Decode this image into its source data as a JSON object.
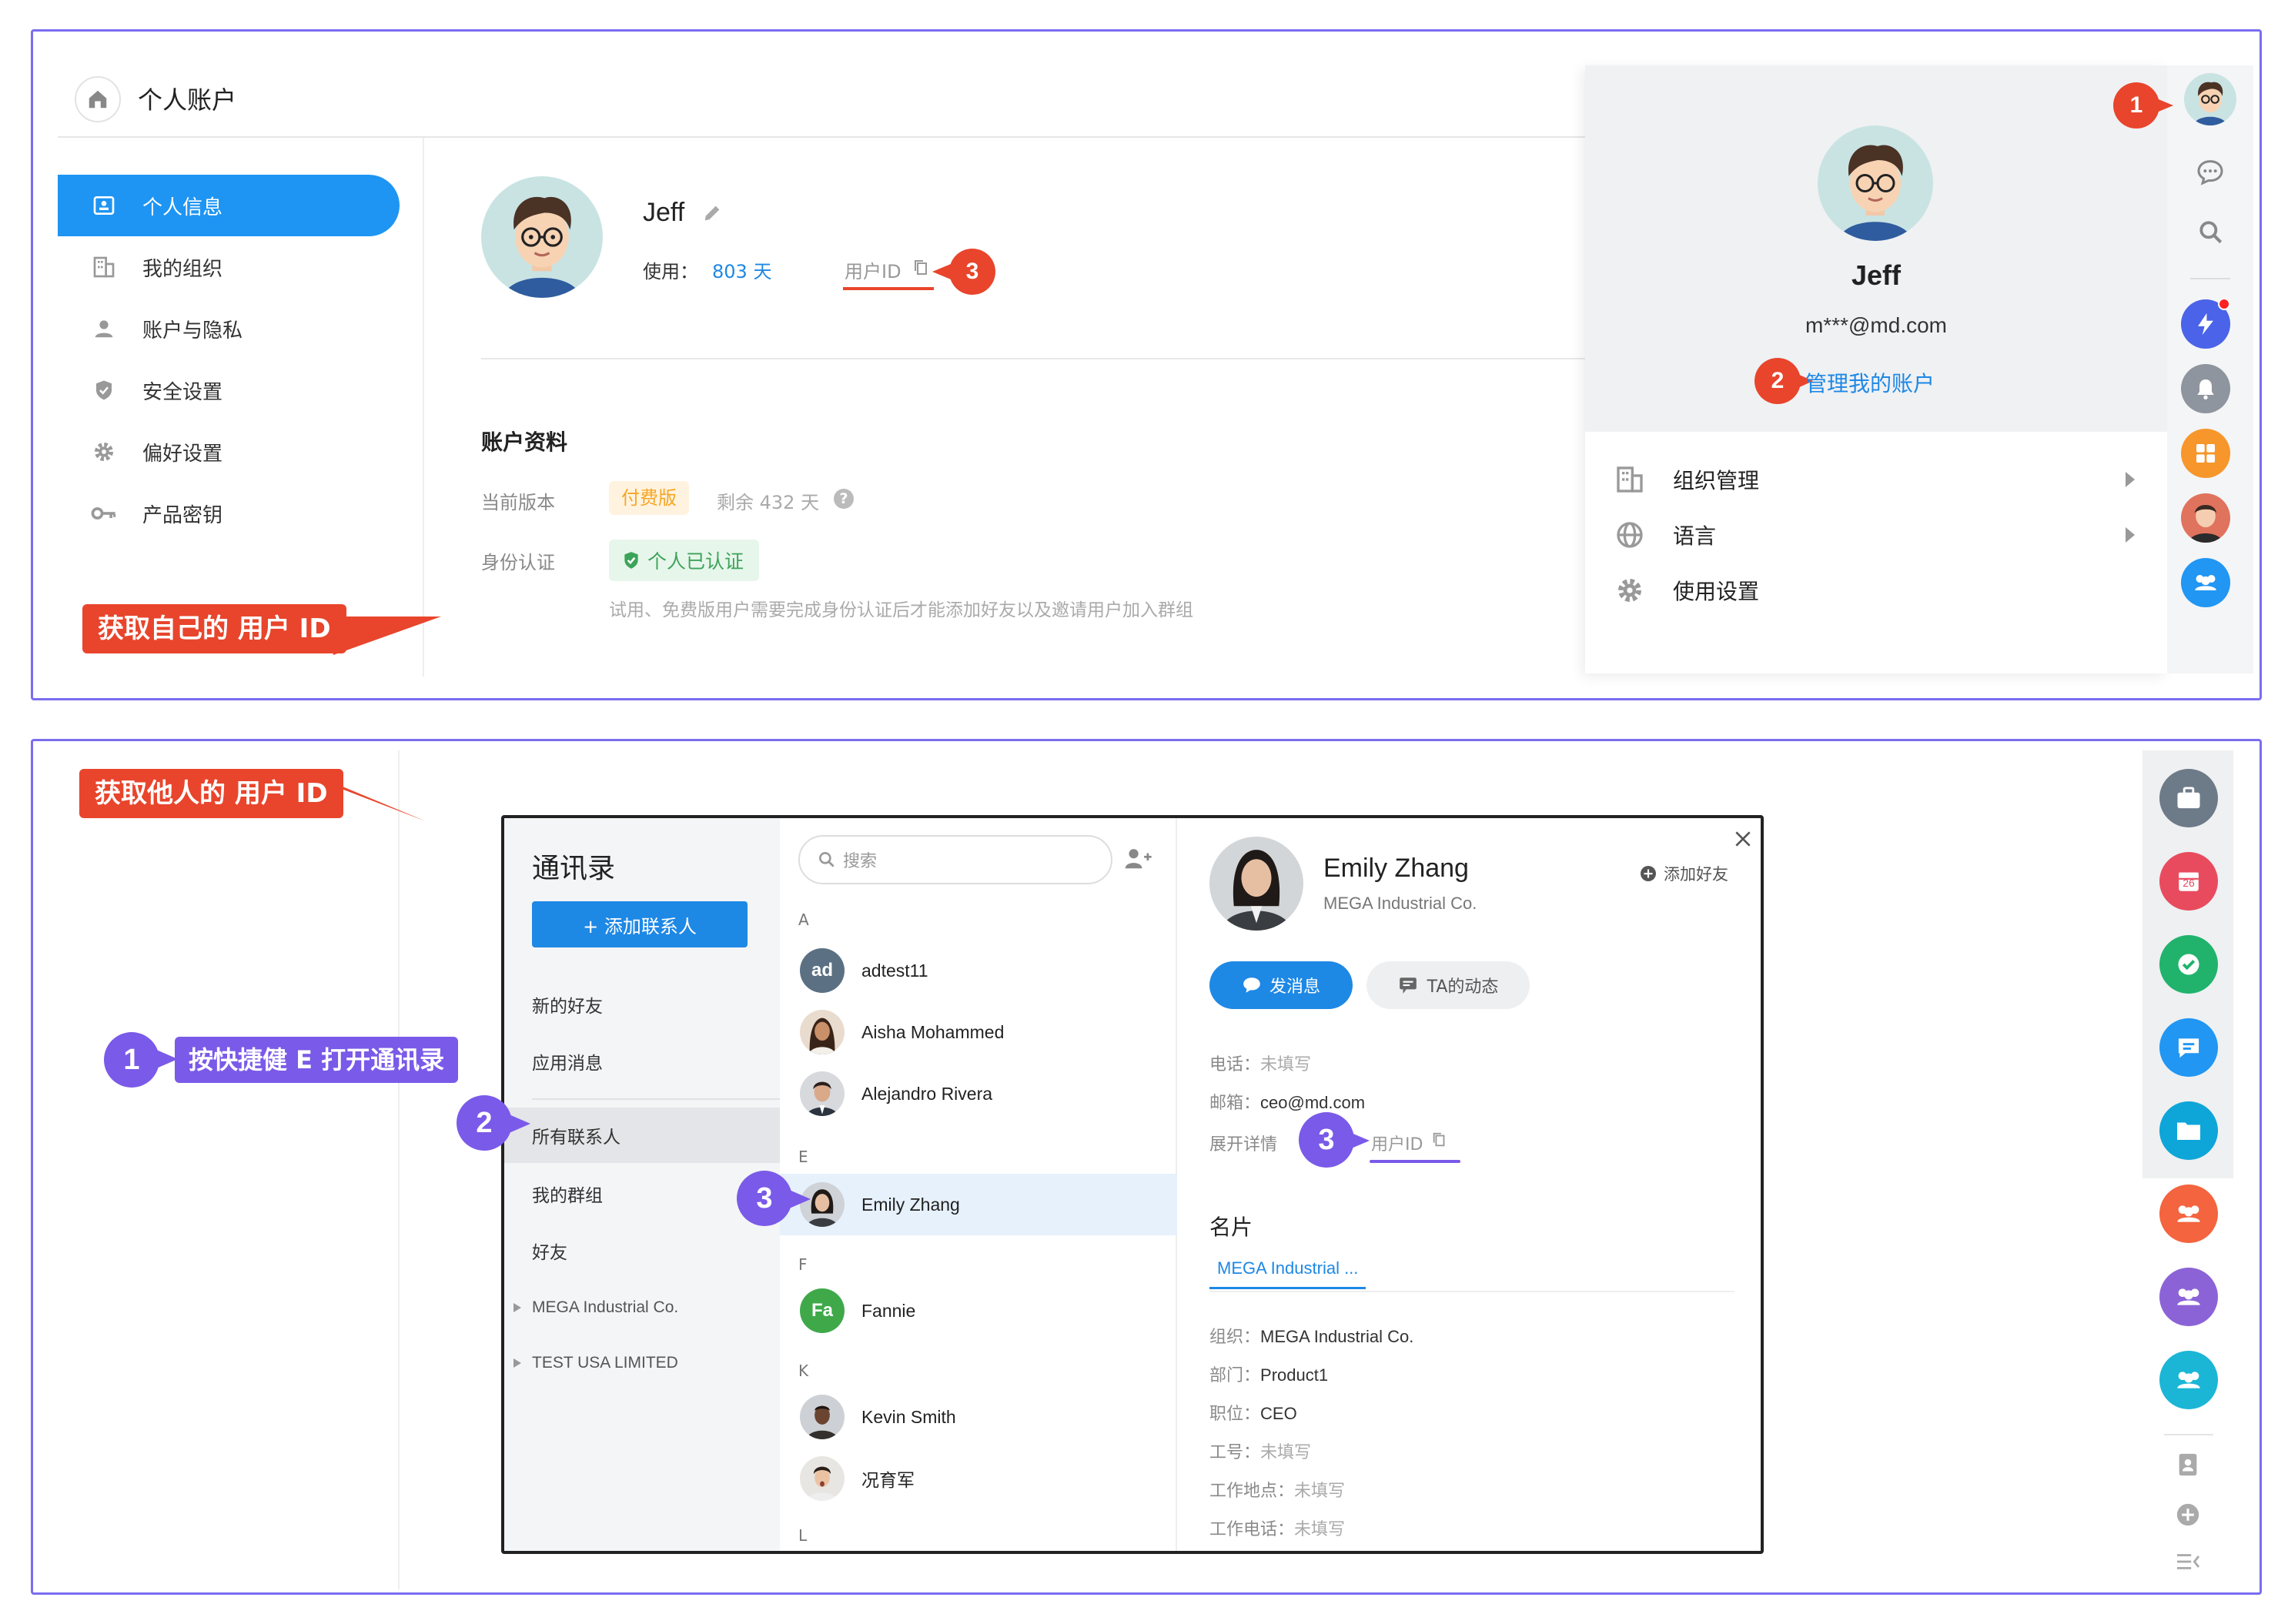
{
  "top": {
    "title": "个人账户",
    "nav": [
      {
        "label": "个人信息",
        "icon": "id-card-icon",
        "active": true
      },
      {
        "label": "我的组织",
        "icon": "building-icon"
      },
      {
        "label": "账户与隐私",
        "icon": "person-icon"
      },
      {
        "label": "安全设置",
        "icon": "shield-icon"
      },
      {
        "label": "偏好设置",
        "icon": "gear-icon"
      },
      {
        "label": "产品密钥",
        "icon": "key-icon"
      }
    ],
    "callout": "获取自己的 用户 ID",
    "profile": {
      "name": "Jeff",
      "usage_label": "使用：",
      "usage_value": "803 天",
      "userid_label": "用户ID",
      "badge": "3"
    },
    "account": {
      "heading": "账户资料",
      "version_label": "当前版本",
      "version_tag": "付费版",
      "remaining": "剩余 432 天",
      "identity_label": "身份认证",
      "identity_tag": "个人已认证",
      "identity_note": "试用、免费版用户需要完成身份认证后才能添加好友以及邀请用户加入群组"
    },
    "dropdown": {
      "name": "Jeff",
      "email": "m***@md.com",
      "manage": "管理我的账户",
      "badge": "2",
      "items": [
        {
          "label": "组织管理",
          "icon": "building-icon",
          "arrow": true
        },
        {
          "label": "语言",
          "icon": "globe-icon",
          "arrow": true
        },
        {
          "label": "使用设置",
          "icon": "gear-icon",
          "arrow": false
        }
      ]
    },
    "avatar_badge": "1"
  },
  "bottom": {
    "callout": "获取他人的 用户 ID",
    "step1_badge": "1",
    "step1_text": "按快捷健 E 打开通讯录",
    "step2_badge": "2",
    "step3_badge": "3",
    "contacts": {
      "title": "通讯录",
      "add_button": "+ 添加联系人",
      "categories": [
        "新的好友",
        "应用消息",
        "所有联系人",
        "我的群组",
        "好友",
        "MEGA Industrial Co.",
        "TEST USA LIMITED"
      ],
      "search_placeholder": "搜索",
      "groups": [
        {
          "letter": "A",
          "items": [
            {
              "name": "adtest11",
              "initials": "ad",
              "color": "#5b7083"
            },
            {
              "name": "Aisha Mohammed",
              "color": "#7a5a48"
            },
            {
              "name": "Alejandro Rivera",
              "color": "#6b6f78"
            }
          ]
        },
        {
          "letter": "E",
          "items": [
            {
              "name": "Emily Zhang",
              "color": "#6d6a6a",
              "selected": true
            }
          ]
        },
        {
          "letter": "F",
          "items": [
            {
              "name": "Fannie",
              "initials": "Fa",
              "color": "#3fa94a"
            }
          ]
        },
        {
          "letter": "K",
          "items": [
            {
              "name": "Kevin Smith",
              "color": "#4e3f37"
            },
            {
              "name": "况育军",
              "color": "#8c7a70"
            }
          ]
        },
        {
          "letter": "L",
          "items": []
        }
      ]
    },
    "detail": {
      "name": "Emily Zhang",
      "company": "MEGA Industrial Co.",
      "add_friend": "添加好友",
      "send_message": "发消息",
      "activity": "TA的动态",
      "phone_label": "电话：",
      "phone_value": "未填写",
      "email_label": "邮箱：",
      "email_value": "ceo@md.com",
      "expand": "展开详情",
      "userid_label": "用户ID",
      "card_heading": "名片",
      "card_tab": "MEGA Industrial ...",
      "org_label": "组织：",
      "org_value": "MEGA Industrial Co.",
      "dept_label": "部门：",
      "dept_value": "Product1",
      "title_label": "职位：",
      "title_value": "CEO",
      "empno_label": "工号：",
      "empno_value": "未填写",
      "loc_label": "工作地点：",
      "loc_value": "未填写",
      "tel_label": "工作电话：",
      "tel_value": "未填写"
    },
    "calendar_day": "26"
  },
  "colors": {
    "frame": "#7b6df0",
    "accent_blue": "#2196f3",
    "badge_red": "#e8452c",
    "badge_purple": "#7a5ae8",
    "paid_orange": "#f5a623",
    "verified_green": "#3ca45a"
  }
}
